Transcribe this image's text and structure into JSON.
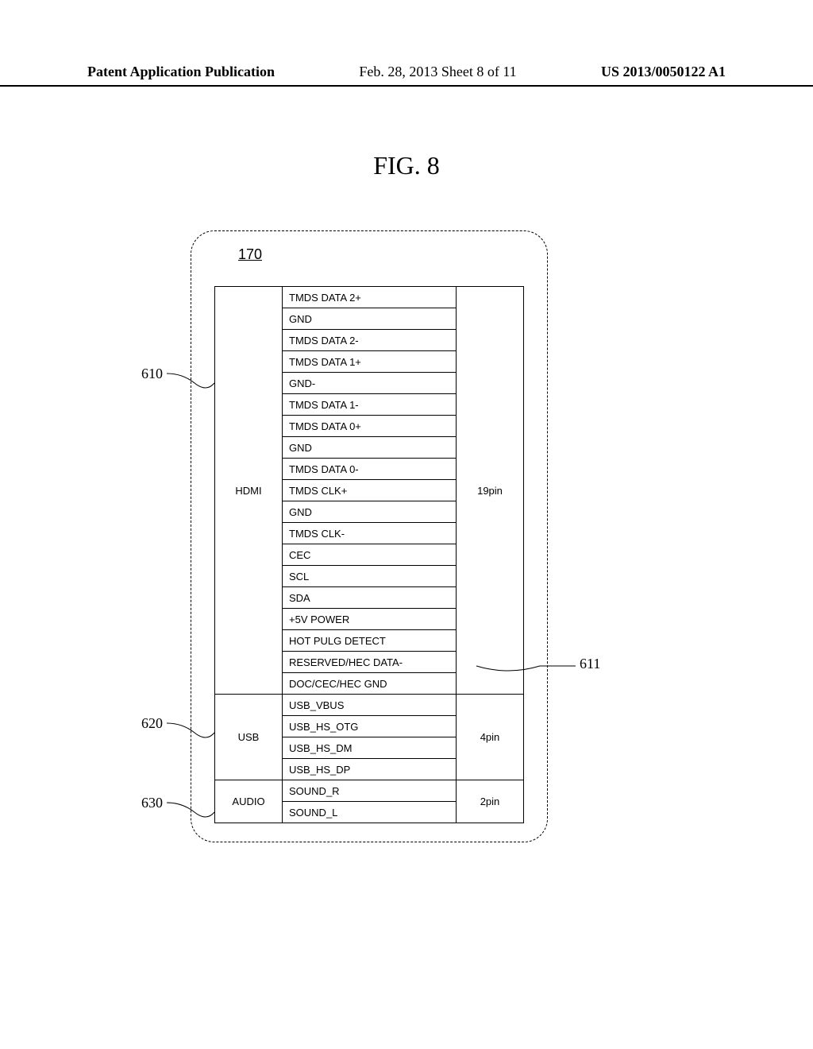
{
  "header": {
    "left": "Patent Application Publication",
    "center": "Feb. 28, 2013  Sheet 8 of 11",
    "right": "US 2013/0050122 A1"
  },
  "figure_title": "FIG. 8",
  "refs": {
    "r170": "170",
    "r610": "610",
    "r620": "620",
    "r630": "630",
    "r611": "611"
  },
  "groups": [
    {
      "name": "HDMI",
      "pin_count": "19pin",
      "signals": [
        "TMDS DATA 2+",
        "GND",
        "TMDS DATA 2-",
        "TMDS DATA 1+",
        "GND-",
        "TMDS DATA 1-",
        "TMDS DATA 0+",
        "GND",
        "TMDS DATA 0-",
        "TMDS CLK+",
        "GND",
        "TMDS CLK-",
        "CEC",
        "SCL",
        "SDA",
        "+5V POWER",
        "HOT PULG DETECT",
        "RESERVED/HEC DATA-",
        "DOC/CEC/HEC GND"
      ]
    },
    {
      "name": "USB",
      "pin_count": "4pin",
      "signals": [
        "USB_VBUS",
        "USB_HS_OTG",
        "USB_HS_DM",
        "USB_HS_DP"
      ]
    },
    {
      "name": "AUDIO",
      "pin_count": "2pin",
      "signals": [
        "SOUND_R",
        "SOUND_L"
      ]
    }
  ]
}
